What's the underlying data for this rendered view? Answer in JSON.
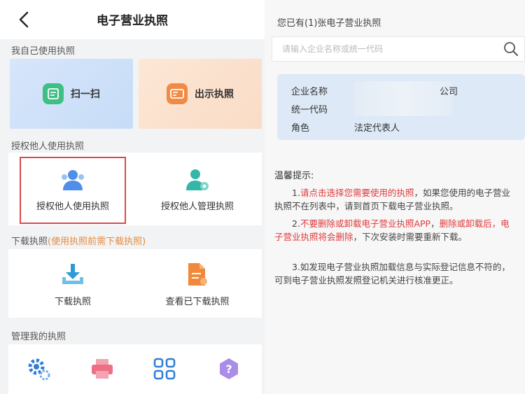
{
  "left": {
    "title": "电子营业执照",
    "section_self": "我自己使用执照",
    "scan_label": "扫一扫",
    "show_label": "出示执照",
    "section_authorize": "授权他人使用执照",
    "auth_use_label": "授权他人使用执照",
    "auth_manage_label": "授权他人管理执照",
    "section_download_prefix": "下载执照",
    "section_download_note": "(使用执照前需下载执照)",
    "download_label": "下载执照",
    "view_downloaded_label": "查看已下载执照",
    "section_manage": "管理我的执照"
  },
  "right": {
    "count_text": "您已有(1)张电子营业执照",
    "search_placeholder": "请输入企业名称或统一代码",
    "card": {
      "name_label": "企业名称",
      "name_suffix": "公司",
      "code_label": "统一代码",
      "role_label": "角色",
      "role_value": "法定代表人"
    },
    "tips_title": "温馨提示:",
    "tip1_prefix": "1.",
    "tip1_red": "请点击选择您需要使用的执照",
    "tip1_rest": "，如果您使用的电子营业执照不在列表中，请到首页下载电子营业执照。",
    "tip2_prefix": "2.",
    "tip2_red1": "不要删除或卸载电子营业执照APP",
    "tip2_mid": "，",
    "tip2_red2": "删除或卸载后，电子营业执照将会删除",
    "tip2_rest": "，下次安装时需要重新下载。",
    "tip3": "3.如发现电子营业执照加载信息与实际登记信息不符的，可到电子营业执照发照登记机关进行核准更正。"
  },
  "colors": {
    "scan_icon": "#3dbf86",
    "show_icon": "#f08a45",
    "people_icon": "#4f8fe8",
    "manage_icon": "#33b7a8",
    "download_icon": "#2e9bd6",
    "doc_icon": "#f0893b",
    "highlight_border": "#d94a4a",
    "tip_red": "#e03a3a",
    "note_orange": "#e58b3c"
  }
}
